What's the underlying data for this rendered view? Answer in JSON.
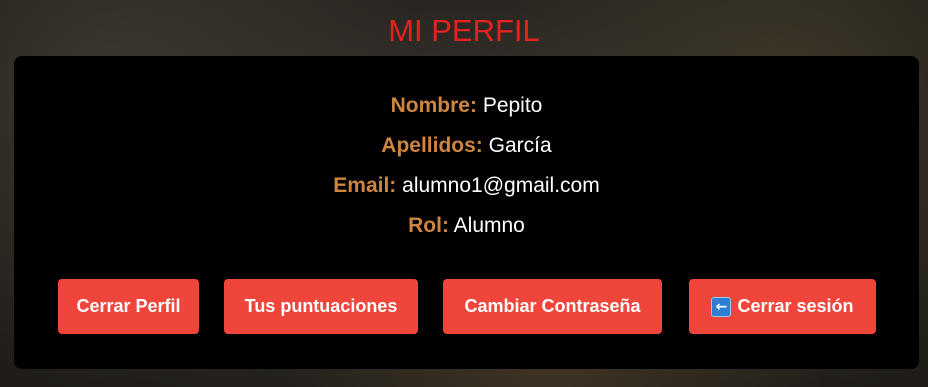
{
  "page": {
    "title": "MI PERFIL"
  },
  "profile": {
    "fields": [
      {
        "label": "Nombre:",
        "value": "Pepito"
      },
      {
        "label": "Apellidos:",
        "value": "García"
      },
      {
        "label": "Email:",
        "value": "alumno1@gmail.com"
      },
      {
        "label": "Rol:",
        "value": "Alumno"
      }
    ]
  },
  "actions": {
    "close_profile": "Cerrar Perfil",
    "scores": "Tus puntuaciones",
    "change_password": "Cambiar Contraseña",
    "logout": "Cerrar sesión",
    "logout_icon": "left-arrow-icon"
  },
  "colors": {
    "title": "#e8201e",
    "label": "#cd853f",
    "button": "#f0453a",
    "card": "#000000"
  }
}
